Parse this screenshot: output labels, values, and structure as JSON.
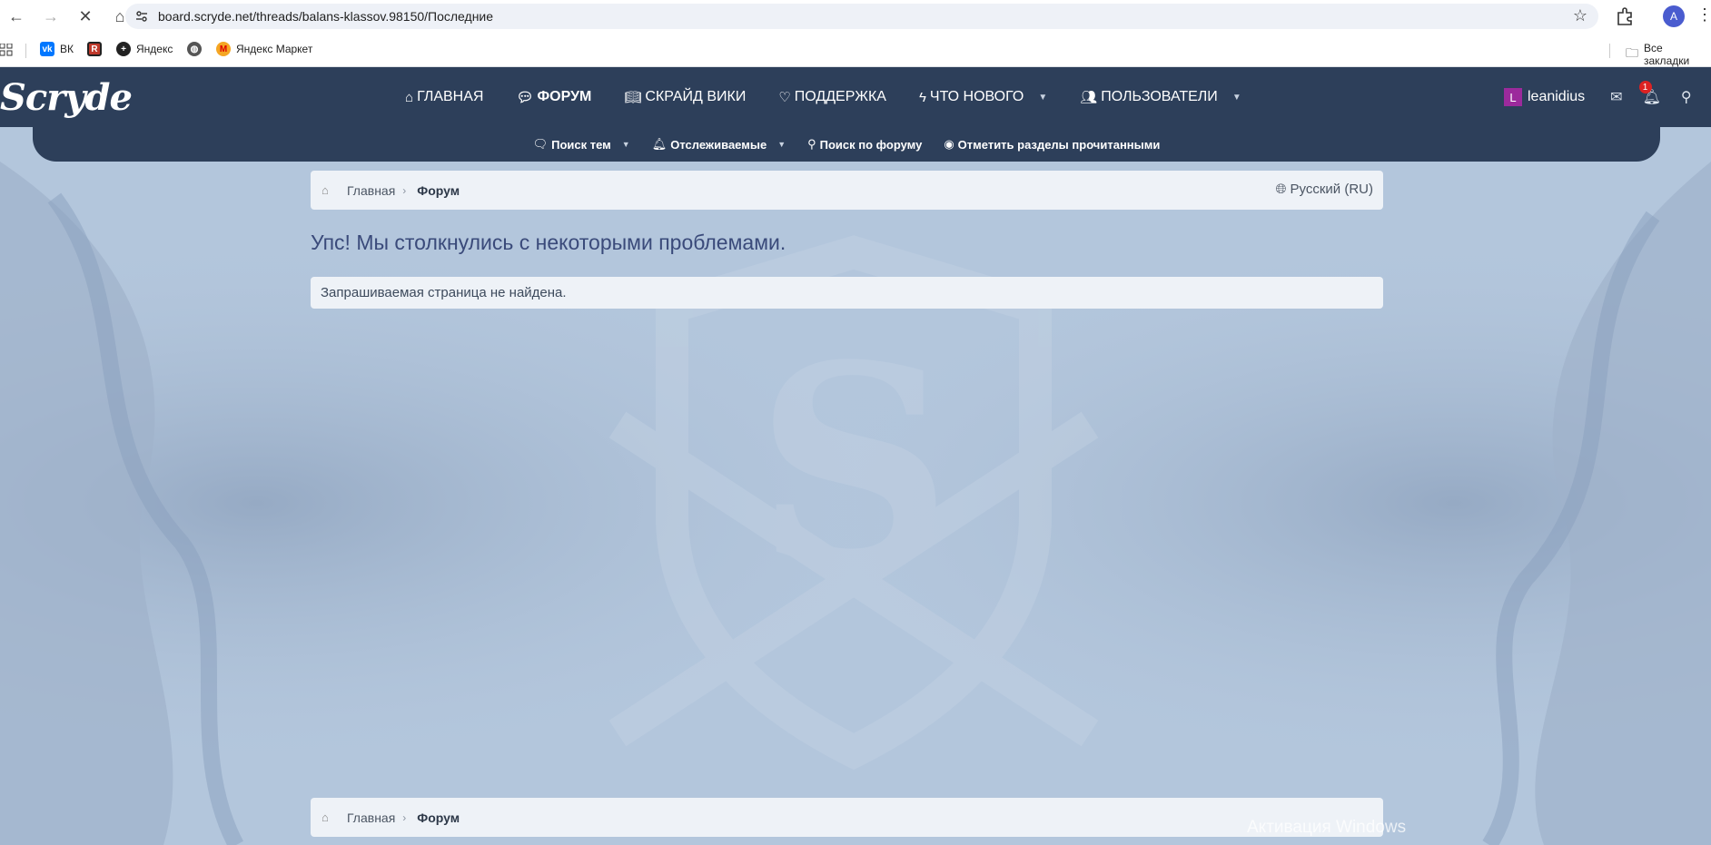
{
  "browser": {
    "url": "board.scryde.net/threads/balans-klassov.98150/Последние",
    "profile_initial": "A",
    "bookmarks": [
      {
        "label": "ВК",
        "icon": "vk-icon",
        "color": "#0077ff"
      },
      {
        "label": "",
        "icon": "ri-icon",
        "color": "#c0392b"
      },
      {
        "label": "Яндекс",
        "icon": "yandex-plus-icon",
        "color": "#222"
      },
      {
        "label": "",
        "icon": "globe-icon",
        "color": "#555"
      },
      {
        "label": "Яндекс Маркет",
        "icon": "yandex-market-icon",
        "color": "#f5a623"
      }
    ],
    "all_bookmarks": "Все закладки"
  },
  "site": {
    "logo": "Scryde",
    "nav": [
      {
        "label": "ГЛАВНАЯ",
        "icon": "home-icon"
      },
      {
        "label": "ФОРУМ",
        "icon": "chat-icon",
        "active": true
      },
      {
        "label": "СКРАЙД ВИКИ",
        "icon": "book-icon"
      },
      {
        "label": "ПОДДЕРЖКА",
        "icon": "heart-icon"
      },
      {
        "label": "ЧТО НОВОГО",
        "icon": "bolt-icon",
        "dropdown": true
      },
      {
        "label": "ПОЛЬЗОВАТЕЛИ",
        "icon": "users-icon",
        "dropdown": true
      }
    ],
    "user": {
      "initial": "L",
      "name": "leanidius",
      "notifications": "1"
    },
    "subnav": [
      {
        "label": "Поиск тем",
        "icon": "speech-icon",
        "dropdown": true
      },
      {
        "label": "Отслеживаемые",
        "icon": "bell-icon",
        "dropdown": true
      },
      {
        "label": "Поиск по форуму",
        "icon": "search-icon",
        "dropdown": false
      },
      {
        "label": "Отметить разделы прочитанными",
        "icon": "eye-slash-icon",
        "dropdown": false
      }
    ]
  },
  "breadcrumb": {
    "home": "Главная",
    "forum": "Форум",
    "language": "Русский (RU)"
  },
  "error": {
    "title": "Упс! Мы столкнулись с некоторыми проблемами.",
    "message": "Запрашиваемая страница не найдена."
  },
  "watermark": "Активация Windows"
}
